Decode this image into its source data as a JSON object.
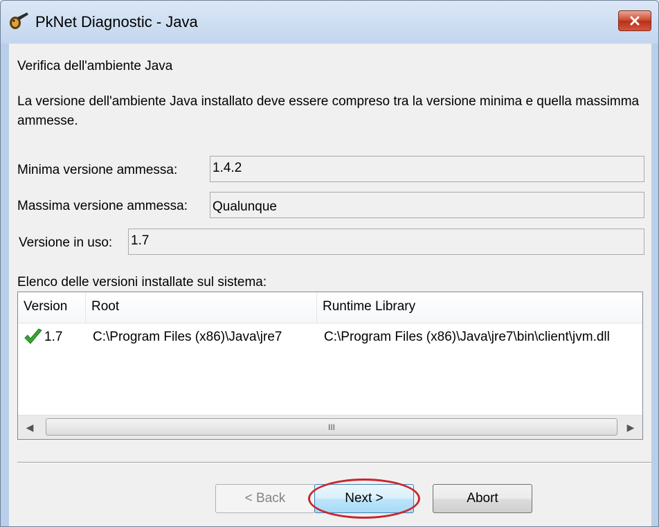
{
  "window": {
    "title": "PkNet Diagnostic - Java",
    "icon": "app-logo-icon",
    "close_icon": "close-icon"
  },
  "page": {
    "heading": "Verifica dell'ambiente Java",
    "description": "La versione dell'ambiente Java installato deve essere compreso tra la versione  minima e quella massimma ammesse."
  },
  "fields": {
    "min_label": "Minima versione ammessa:",
    "min_value": "1.4.2",
    "max_label": "Massima versione ammessa:",
    "max_value": "Qualunque",
    "current_label": "Versione in uso:",
    "current_value": "1.7"
  },
  "list": {
    "label": "Elenco delle versioni installate sul sistema:",
    "columns": [
      "Version",
      "Root",
      "Runtime Library"
    ],
    "rows": [
      {
        "status_icon": "checkmark-icon",
        "version": "1.7",
        "root": "C:\\Program Files (x86)\\Java\\jre7",
        "runtime": "C:\\Program Files (x86)\\Java\\jre7\\bin\\client\\jvm.dll"
      }
    ],
    "scroll_grip": "III"
  },
  "buttons": {
    "back": "< Back",
    "next": "Next >",
    "abort": "Abort"
  },
  "colors": {
    "highlight_ring": "#c8262c",
    "checkmark": "#3aa335"
  }
}
